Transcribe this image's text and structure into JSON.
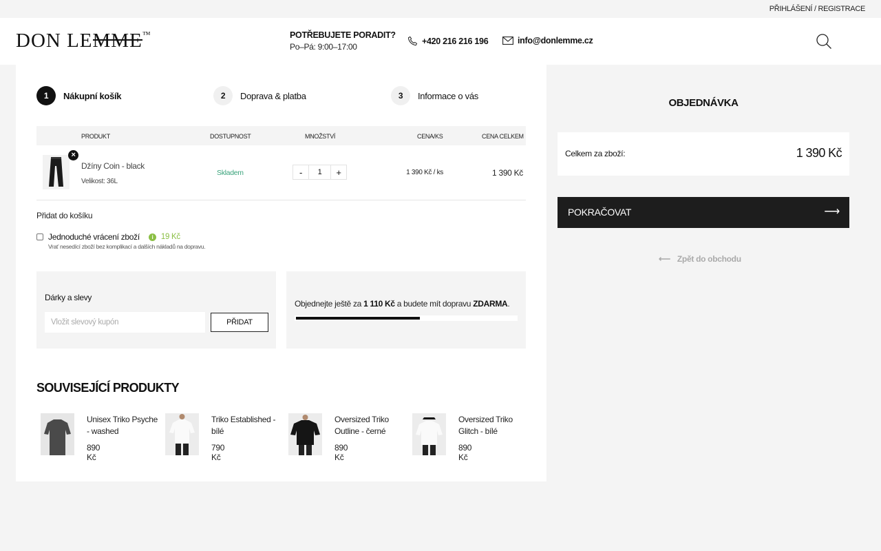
{
  "topbar": {
    "login": "PŘIHLÁŠENÍ",
    "sep": "/",
    "register": "REGISTRACE"
  },
  "header": {
    "logo_a": "DON LE",
    "logo_b": "MME",
    "logo_tm": "™",
    "advice_title": "POTŘEBUJETE PORADIT?",
    "advice_hours": "Po–Pá: 9:00–17:00",
    "phone": "+420 216 216 196",
    "email": "info@donlemme.cz"
  },
  "steps": [
    {
      "num": "1",
      "label": "Nákupní košík"
    },
    {
      "num": "2",
      "label": "Doprava & platba"
    },
    {
      "num": "3",
      "label": "Informace o vás"
    }
  ],
  "table": {
    "headers": {
      "product": "PRODUKT",
      "availability": "DOSTUPNOST",
      "quantity": "MNOŽSTVÍ",
      "unit_price": "CENA/KS",
      "total": "CENA CELKEM"
    },
    "item": {
      "remove": "×",
      "name": "Džíny Coin - black",
      "size": "Velikost: 36L",
      "availability": "Skladem",
      "minus": "-",
      "qty": "1",
      "plus": "+",
      "unit_price": "1 390 Kč  / ks",
      "total": "1 390 Kč"
    }
  },
  "addons": {
    "title": "Přidat do košíku",
    "easy_return_label": "Jednoduché vrácení zboží",
    "easy_return_info": "i",
    "easy_return_price": "19 Kč",
    "easy_return_desc": "Vrať nesedící zboží bez komplikací a dalších nákladů na dopravu."
  },
  "gifts": {
    "title": "Dárky a slevy",
    "placeholder": "Vložit slevový kupón",
    "button": "PŘIDAT"
  },
  "shipping": {
    "pre": "Objednejte ještě za ",
    "amount": "1 110 Kč",
    "mid": " a budete mít dopravu ",
    "free": "ZDARMA",
    "post": ".",
    "progress": 0.555
  },
  "related": {
    "title": "SOUVISEJÍCÍ PRODUKTY",
    "items": [
      {
        "name": "Unisex Triko Psyche - washed",
        "price": "890 Kč"
      },
      {
        "name": "Triko Established - bílé",
        "price": "790 Kč"
      },
      {
        "name": "Oversized Triko Outline - černé",
        "price": "890 Kč"
      },
      {
        "name": "Oversized Triko Glitch - bílé",
        "price": "890 Kč"
      }
    ]
  },
  "summary": {
    "title": "OBJEDNÁVKA",
    "goods_label": "Celkem za zboží:",
    "goods_total": "1 390 Kč",
    "continue": "POKRAČOVAT",
    "continue_arrow": "⟶",
    "back_arrow": "⟵",
    "back": "Zpět do obchodu"
  },
  "colors": {
    "accent_dark": "#1d1d1d",
    "in_stock": "#3aa37b",
    "addon_green": "#8bbf45"
  }
}
